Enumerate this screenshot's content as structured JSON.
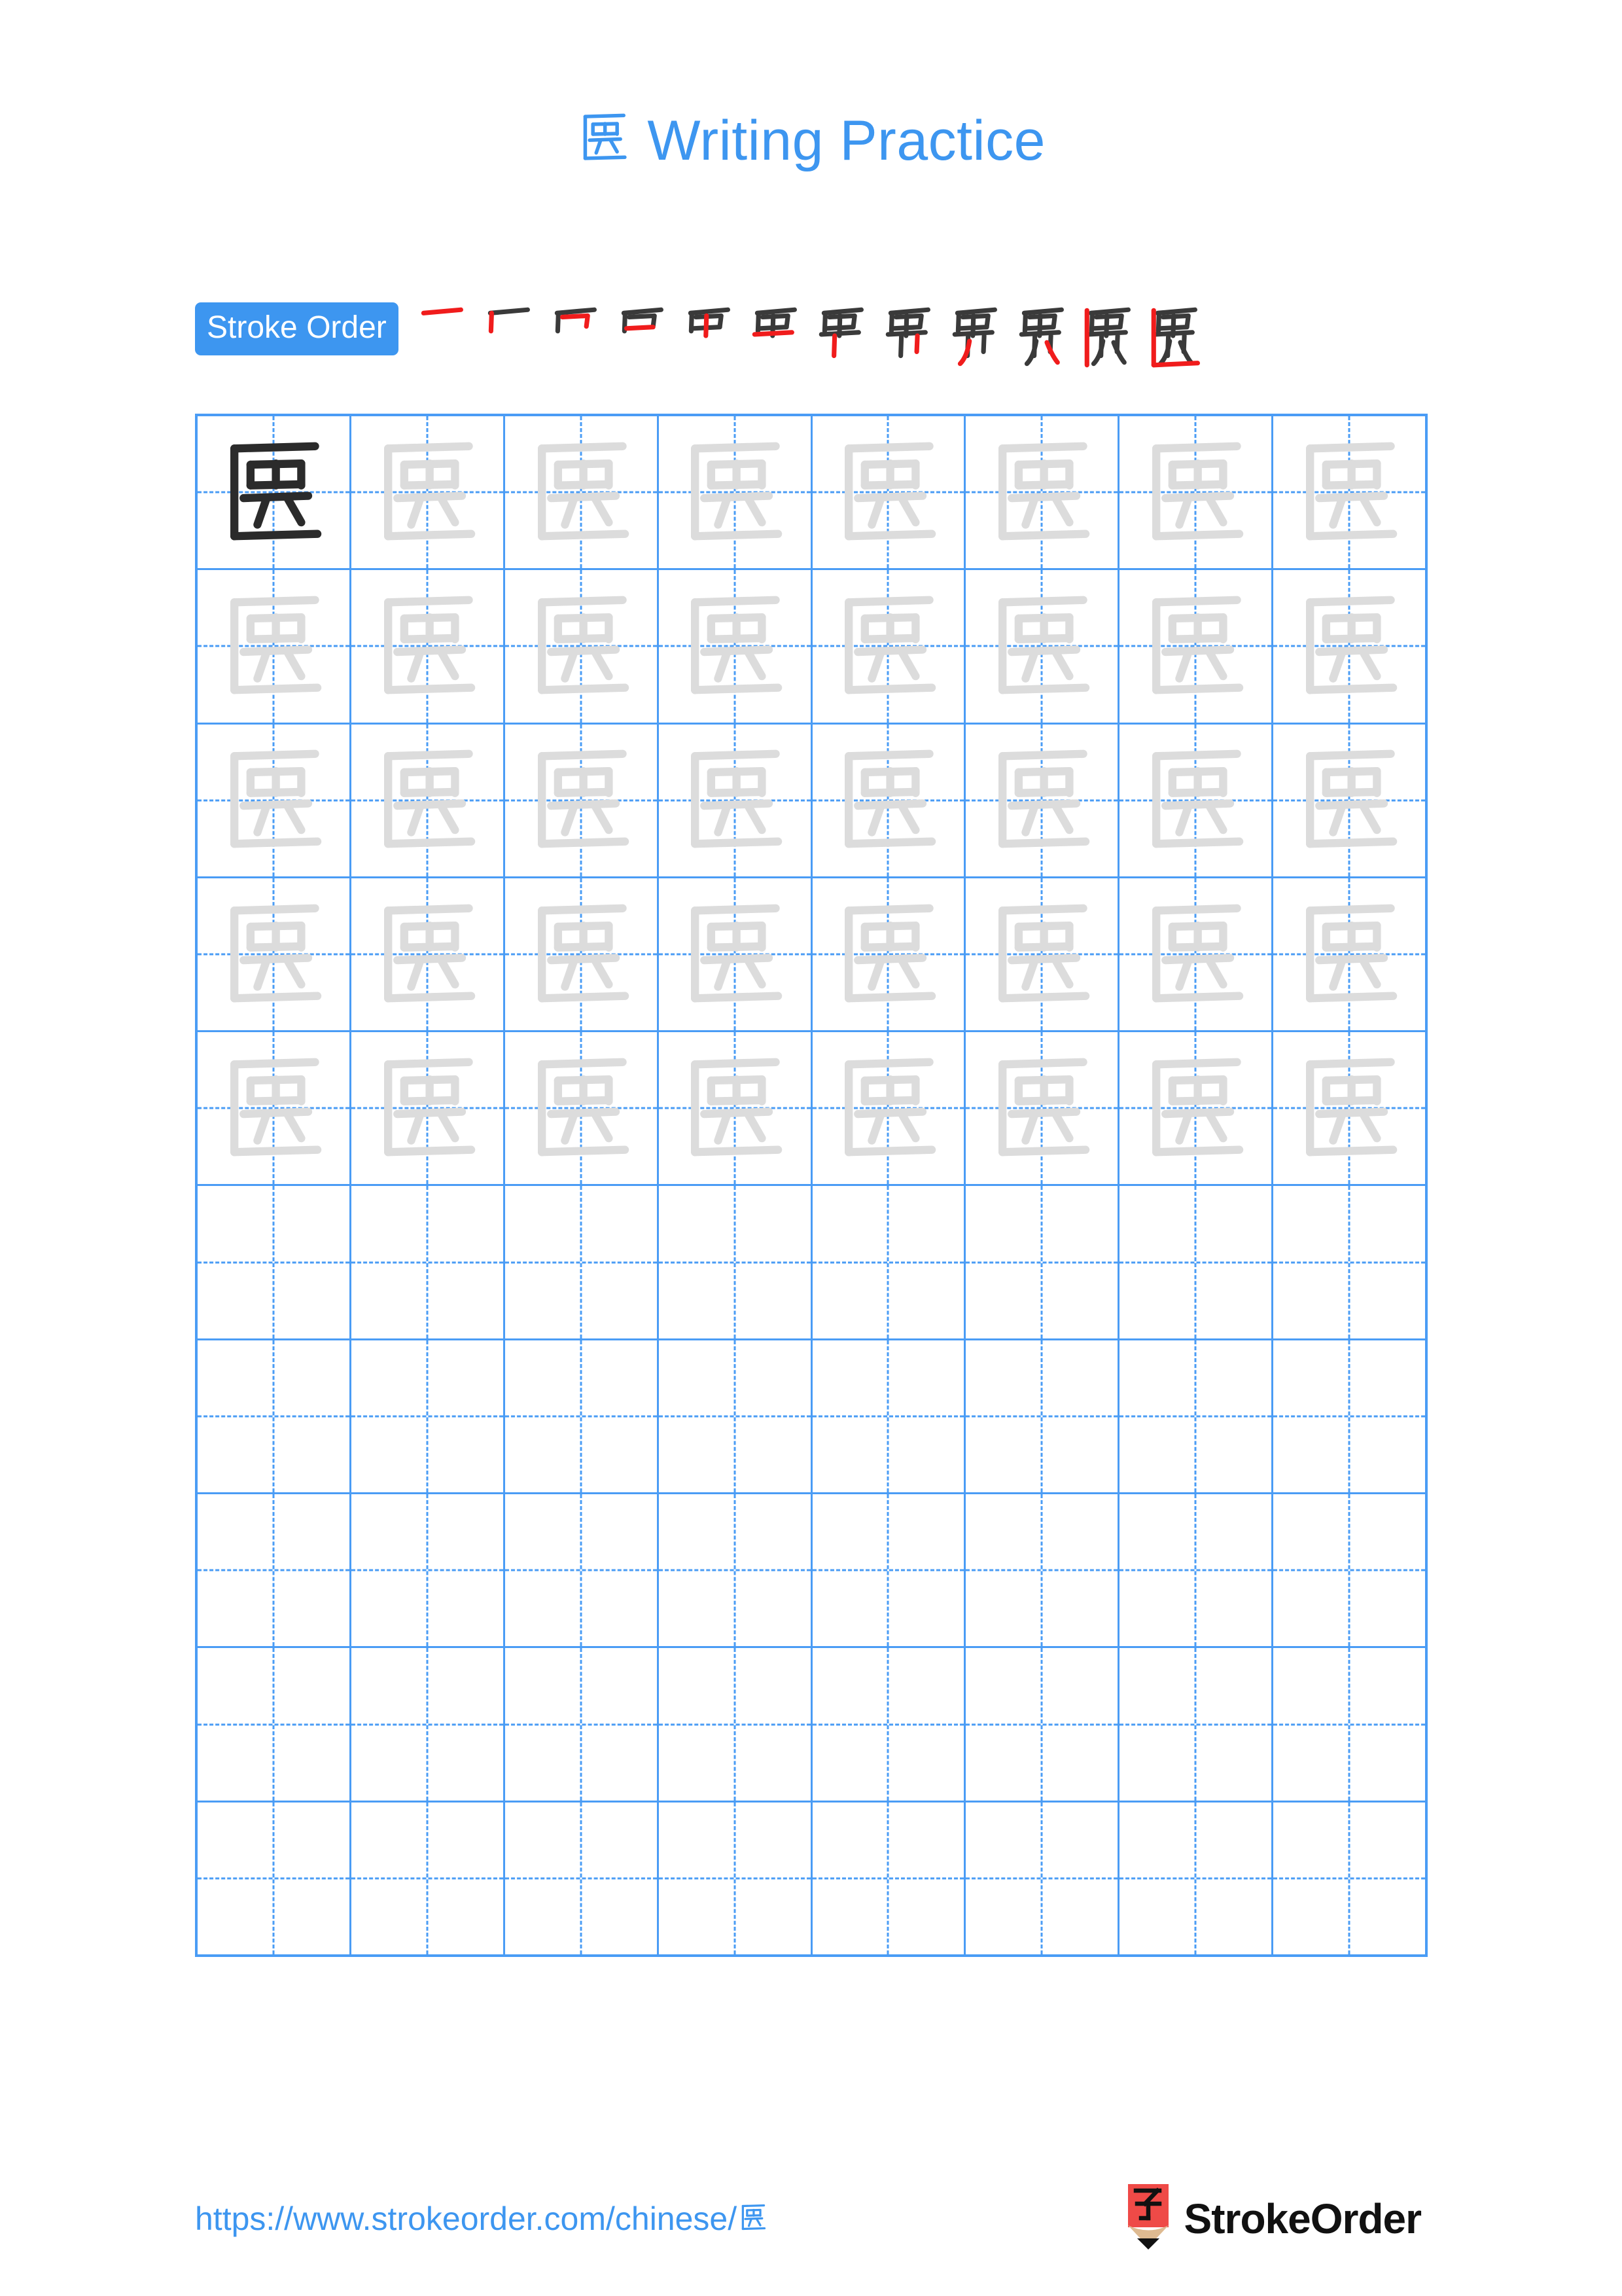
{
  "document": {
    "character": "匮",
    "title_suffix": "Writing Practice"
  },
  "stroke_order": {
    "badge_label": "Stroke Order",
    "total_steps": 12,
    "step_numbers": [
      1,
      2,
      3,
      4,
      5,
      6,
      7,
      8,
      9,
      10,
      11,
      12
    ],
    "new_stroke_color": "#F01C1C",
    "existing_stroke_color": "#3A3A3A"
  },
  "grid": {
    "columns": 8,
    "rows": 10,
    "filled_rows": 5,
    "empty_rows": 5,
    "total_cells": 80,
    "traced_cells": 40,
    "model_cell": {
      "row": 1,
      "column": 1
    },
    "line_color": "#4A9CF5",
    "model_glyph_color": "#2B2B2B",
    "trace_glyph_color": "#DCDCDC"
  },
  "footer": {
    "url_text": "https://www.strokeorder.com/chinese/",
    "url_character": "匮",
    "brand_name": "StrokeOrder",
    "logo_character": "字",
    "logo_red": "#EF4A47",
    "logo_wood": "#DEBA91",
    "logo_tip": "#111111"
  },
  "theme": {
    "accent_blue": "#3D96F0",
    "grid_blue": "#4A9CF5",
    "background": "#FFFFFF"
  }
}
